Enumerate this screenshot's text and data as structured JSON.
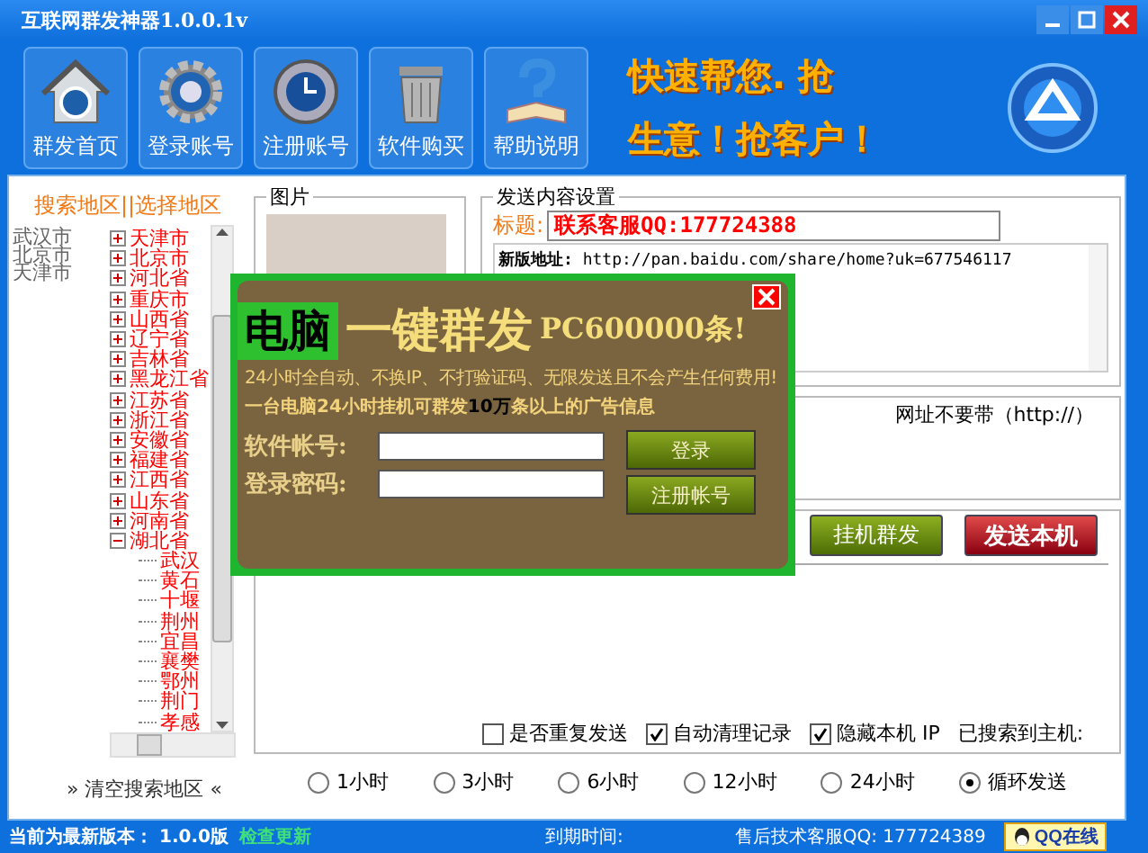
{
  "window": {
    "title": "互联网群发神器1.0.0.1v"
  },
  "window_controls": [
    {
      "kind": "minimize"
    },
    {
      "kind": "maximize"
    },
    {
      "kind": "close"
    }
  ],
  "toolbar": {
    "buttons": [
      {
        "label": "群发首页",
        "kind": "home"
      },
      {
        "label": "登录账号",
        "kind": "gear"
      },
      {
        "label": "注册账号",
        "kind": "clock"
      },
      {
        "label": "软件购买",
        "kind": "trash"
      },
      {
        "label": "帮助说明",
        "kind": "help"
      }
    ],
    "slogan": [
      "快速帮您. 抢",
      "生意！抢客户！"
    ]
  },
  "region_panel": {
    "header": "搜索地区||选择地区",
    "selected_regions": [
      "武汉市",
      "北京市",
      "天津市"
    ],
    "tree": [
      {
        "label": "天津市",
        "expanded": false
      },
      {
        "label": "北京市",
        "expanded": false
      },
      {
        "label": "河北省",
        "expanded": false
      },
      {
        "label": "重庆市",
        "expanded": false
      },
      {
        "label": "山西省",
        "expanded": false
      },
      {
        "label": "辽宁省",
        "expanded": false
      },
      {
        "label": "吉林省",
        "expanded": false
      },
      {
        "label": "黑龙江省",
        "expanded": false
      },
      {
        "label": "江苏省",
        "expanded": false
      },
      {
        "label": "浙江省",
        "expanded": false
      },
      {
        "label": "安徽省",
        "expanded": false
      },
      {
        "label": "福建省",
        "expanded": false
      },
      {
        "label": "江西省",
        "expanded": false
      },
      {
        "label": "山东省",
        "expanded": false
      },
      {
        "label": "河南省",
        "expanded": false
      },
      {
        "label": "湖北省",
        "expanded": true,
        "children": [
          {
            "label": "武汉"
          },
          {
            "label": "黄石"
          },
          {
            "label": "十堰"
          },
          {
            "label": "荆州"
          },
          {
            "label": "宜昌"
          },
          {
            "label": "襄樊"
          },
          {
            "label": "鄂州"
          },
          {
            "label": "荆门"
          },
          {
            "label": "孝感"
          }
        ]
      }
    ],
    "clear_link": "» 清空搜索地区 «"
  },
  "picture_group": {
    "title": "图片"
  },
  "send_settings": {
    "title": "发送内容设置",
    "subject_label": "标题:",
    "subject_value": "联系客服QQ:177724388",
    "content": "**新版地址:** http://pan.baidu.com/share/home?uk=677546117"
  },
  "url_group": {
    "hint": "网址不要带（http://）"
  },
  "actions": [
    {
      "label": "挂机群发",
      "kind": "normal"
    },
    {
      "label": "发送本机",
      "kind": "primary"
    }
  ],
  "options": [
    {
      "label": "是否重复发送",
      "checked": false
    },
    {
      "label": "自动清理记录",
      "checked": true
    },
    {
      "label": "隐藏本机 IP",
      "checked": true
    }
  ],
  "search_status": "已搜索到主机:",
  "schedule": [
    {
      "label": "1小时",
      "selected": false
    },
    {
      "label": "3小时",
      "selected": false
    },
    {
      "label": "6小时",
      "selected": false
    },
    {
      "label": "12小时",
      "selected": false
    },
    {
      "label": "24小时",
      "selected": false
    },
    {
      "label": "循环发送",
      "selected": true
    }
  ],
  "status_bar": {
    "version": "当前为最新版本： 1.0.0版",
    "update_link": "检查更新",
    "expiry": "到期时间:",
    "support": "售后技术客服QQ: 177724389",
    "qq_button": "QQ在线"
  },
  "popup": {
    "tag": "电脑",
    "headline": "一键群发",
    "count": "PC600000条!",
    "subtitle": "24小时全自动、不换IP、不打验证码、无限发送且不会产生任何费用!",
    "note": "一台电脑24小时挂机可群发**10万**条以上的广告信息",
    "fields": [
      {
        "label": "软件帐号:"
      },
      {
        "label": "登录密码:"
      }
    ],
    "buttons": [
      "登录",
      "注册帐号"
    ]
  }
}
